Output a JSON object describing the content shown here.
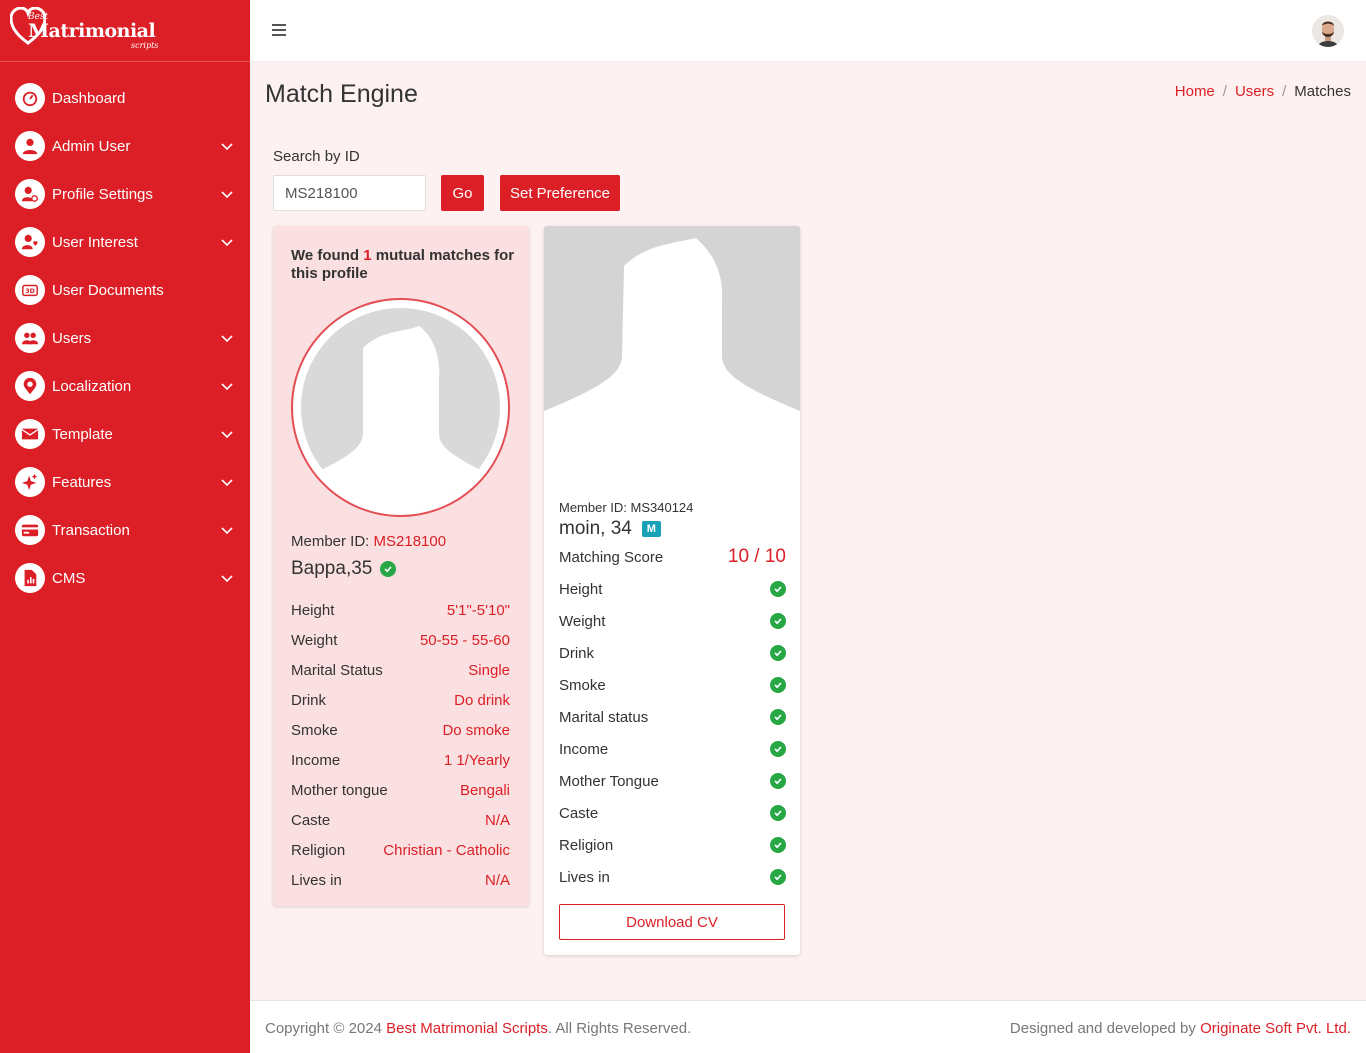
{
  "brand": {
    "best": "Best",
    "name": "Matrimonial",
    "sub": "scripts"
  },
  "sidebar": {
    "items": [
      {
        "label": "Dashboard",
        "icon": "dashboard-icon",
        "chevron": false
      },
      {
        "label": "Admin User",
        "icon": "user-icon",
        "chevron": true
      },
      {
        "label": "Profile Settings",
        "icon": "user-cog-icon",
        "chevron": true
      },
      {
        "label": "User Interest",
        "icon": "user-heart-icon",
        "chevron": true
      },
      {
        "label": "User Documents",
        "icon": "3d-document-icon",
        "chevron": false
      },
      {
        "label": "Users",
        "icon": "users-icon",
        "chevron": true
      },
      {
        "label": "Localization",
        "icon": "location-pin-icon",
        "chevron": true
      },
      {
        "label": "Template",
        "icon": "envelope-icon",
        "chevron": true
      },
      {
        "label": "Features",
        "icon": "sparkle-icon",
        "chevron": true
      },
      {
        "label": "Transaction",
        "icon": "credit-card-icon",
        "chevron": true
      },
      {
        "label": "CMS",
        "icon": "file-chart-icon",
        "chevron": true
      }
    ]
  },
  "page": {
    "title": "Match Engine"
  },
  "breadcrumb": {
    "home": "Home",
    "users": "Users",
    "current": "Matches",
    "sep": "/"
  },
  "search": {
    "label": "Search by ID",
    "value": "MS218100",
    "go": "Go",
    "preference": "Set Preference"
  },
  "profile": {
    "found_pre": "We found ",
    "found_count": "1",
    "found_post": " mutual matches for this profile",
    "member_label": "Member ID: ",
    "member_id": "MS218100",
    "name": "Bappa,35",
    "verified": true,
    "details": [
      {
        "label": "Height",
        "value": "5'1\"-5'10\""
      },
      {
        "label": "Weight",
        "value": "50-55 - 55-60"
      },
      {
        "label": "Marital Status",
        "value": "Single"
      },
      {
        "label": "Drink",
        "value": "Do drink"
      },
      {
        "label": "Smoke",
        "value": "Do smoke"
      },
      {
        "label": "Income",
        "value": "1 1/Yearly"
      },
      {
        "label": "Mother tongue",
        "value": "Bengali"
      },
      {
        "label": "Caste",
        "value": "N/A"
      },
      {
        "label": "Religion",
        "value": "Christian - Catholic"
      },
      {
        "label": "Lives in",
        "value": "N/A"
      }
    ]
  },
  "match": {
    "member_id_text": "Member ID: MS340124",
    "name": "moin, 34",
    "badge": "M",
    "score_label": "Matching Score",
    "score": "10 / 10",
    "criteria": [
      "Height",
      "Weight",
      "Drink",
      "Smoke",
      "Marital status",
      "Income",
      "Mother Tongue",
      "Caste",
      "Religion",
      "Lives in"
    ],
    "download": "Download CV"
  },
  "footer": {
    "copy_pre": "Copyright © 2024 ",
    "copy_link": "Best Matrimonial Scripts",
    "copy_post": ". All Rights Reserved.",
    "design_pre": "Designed and developed by ",
    "design_link": "Originate Soft Pvt. Ltd."
  },
  "colors": {
    "primary": "#dc1f26",
    "success": "#28a745",
    "badge": "#17a2b8",
    "background": "#fdf1f1",
    "card_pink": "#fbe0e1"
  }
}
